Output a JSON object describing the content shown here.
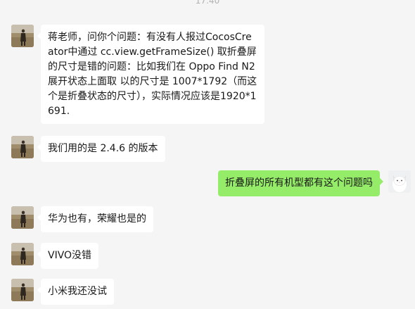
{
  "chat": {
    "timestamp": "17:40",
    "messages": [
      {
        "side": "left",
        "avatar_icon": "landscape-person-avatar",
        "text": "蒋老师，问你个问题：有没有人报过CocosCreator中通过 cc.view.getFrameSize() 取折叠屏的尺寸是错的问题：比如我们在 Oppo Find N2 展开状态上面取 以的尺寸是 1007*1792（而这个是折叠状态的尺寸），实际情况应该是1920*1691."
      },
      {
        "side": "left",
        "avatar_icon": "landscape-person-avatar",
        "text": "我们用的是 2.4.6 的版本"
      },
      {
        "side": "right",
        "avatar_icon": "white-cat-avatar",
        "text": "折叠屏的所有机型都有这个问题吗"
      },
      {
        "side": "left",
        "avatar_icon": "landscape-person-avatar",
        "text": "华为也有，荣耀也是的"
      },
      {
        "side": "left",
        "avatar_icon": "landscape-person-avatar",
        "text": "VIVO没错"
      },
      {
        "side": "left",
        "avatar_icon": "landscape-person-avatar",
        "text": "小米我还没试"
      }
    ]
  },
  "colors": {
    "background": "#f5f5f5",
    "incoming_bubble": "#ffffff",
    "outgoing_bubble": "#95ec69",
    "text": "#191919"
  }
}
